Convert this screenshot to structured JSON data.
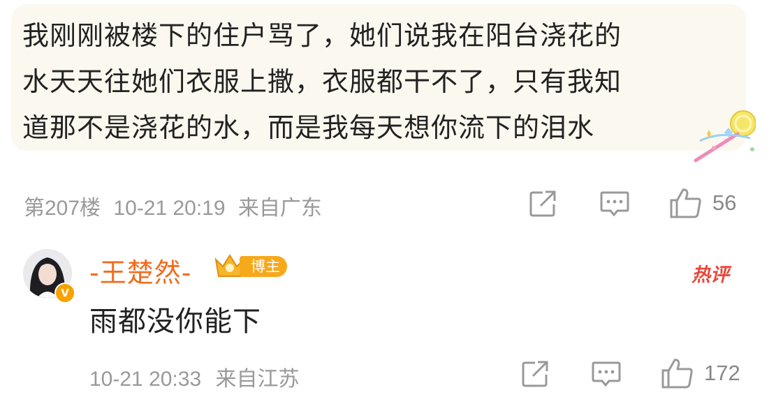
{
  "comment": {
    "lines": [
      "我刚刚被楼下的住户骂了，她们说我在阳台浇花的",
      "水天天往她们衣服上撒，衣服都干不了，只有我知",
      "道那不是浇花的水，而是我每天想你流下的泪水"
    ],
    "floor": "第207楼",
    "time": "10-21 20:19",
    "location": "来自广东",
    "like_count": "56"
  },
  "reply": {
    "username": "-王楚然-",
    "badge_label": "博主",
    "verified_mark": "V",
    "hot_tag": "热评",
    "text": "雨都没你能下",
    "time": "10-21 20:33",
    "location": "来自江苏",
    "like_count": "172"
  },
  "icons": [
    "share-icon",
    "comment-icon",
    "like-icon",
    "crown-icon",
    "wand-sticker-icon"
  ],
  "colors": {
    "username": "#f26b1d",
    "badge": "#f7a81b",
    "hot_tag": "#e8483b",
    "meta": "#999999",
    "bubble_bg": "#fbf8ef"
  }
}
